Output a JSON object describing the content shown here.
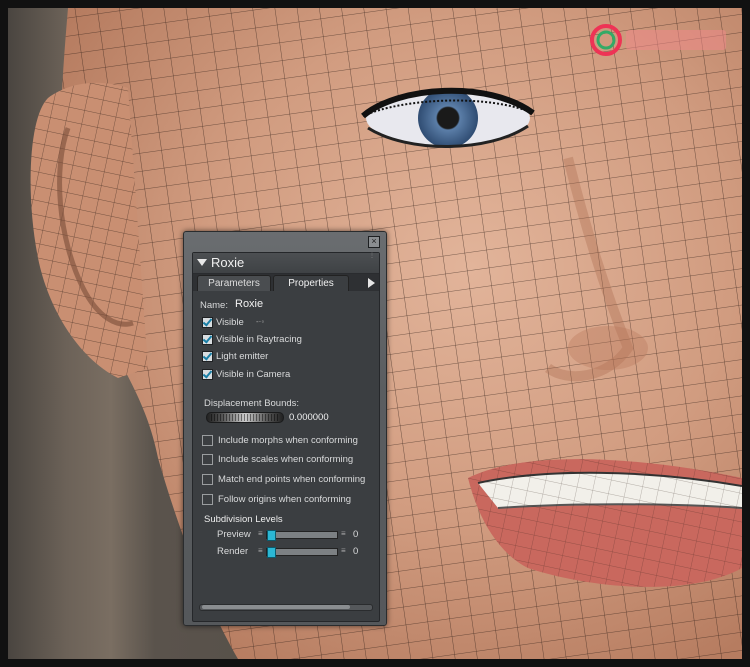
{
  "panel": {
    "title": "Roxie",
    "tabs": [
      {
        "label": "Parameters",
        "active": false
      },
      {
        "label": "Properties",
        "active": true
      }
    ],
    "name_label": "Name:",
    "name_value": "Roxie",
    "checkboxes": [
      {
        "label": "Visible",
        "checked": true
      },
      {
        "label": "Visible in Raytracing",
        "checked": true
      },
      {
        "label": "Light emitter",
        "checked": true
      },
      {
        "label": "Visible in Camera",
        "checked": true
      }
    ],
    "displacement": {
      "label": "Displacement Bounds:",
      "value": "0.000000"
    },
    "options": [
      {
        "label": "Include morphs when conforming",
        "checked": false
      },
      {
        "label": "Include scales when conforming",
        "checked": false
      },
      {
        "label": "Match end points when conforming",
        "checked": false
      },
      {
        "label": "Follow origins when conforming",
        "checked": false
      }
    ],
    "subdivision": {
      "title": "Subdivision Levels",
      "preview": {
        "label": "Preview",
        "value": "0"
      },
      "render": {
        "label": "Render",
        "value": "0"
      }
    }
  },
  "colors": {
    "accent": "#2bb7d4",
    "panel_bg": "#3b3e41"
  },
  "icons": [
    "collapse-triangle-icon",
    "close-icon",
    "tab-menu-arrow-icon",
    "checkbox-icon"
  ]
}
